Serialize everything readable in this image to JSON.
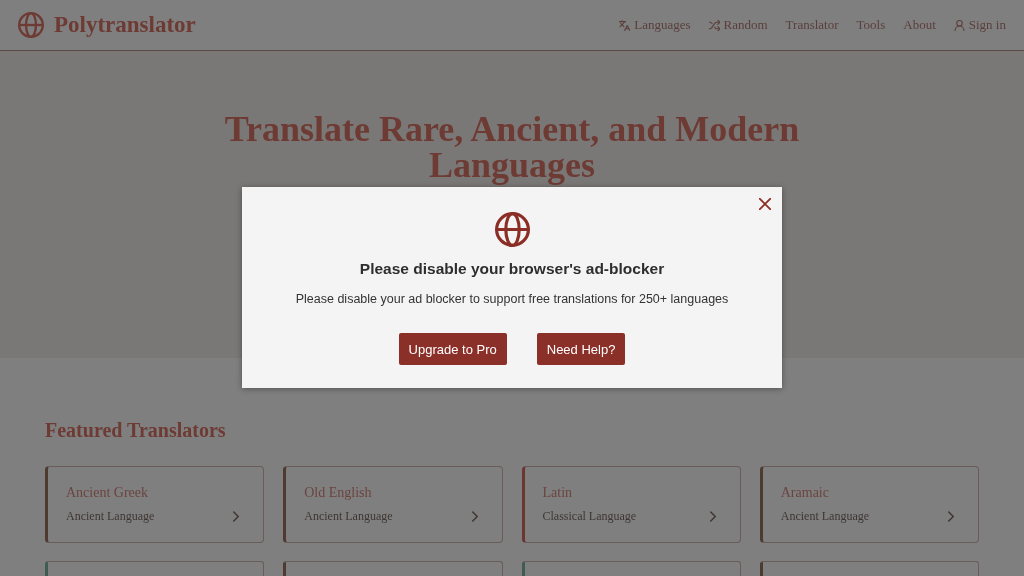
{
  "header": {
    "brand": "Polytranslator",
    "nav": [
      {
        "label": "Languages",
        "kind": "translate"
      },
      {
        "label": "Random",
        "kind": "shuffle"
      },
      {
        "label": "Translator",
        "kind": "plain"
      },
      {
        "label": "Tools",
        "kind": "plain"
      },
      {
        "label": "About",
        "kind": "plain"
      },
      {
        "label": "Sign in",
        "kind": "account"
      }
    ]
  },
  "hero": {
    "title": "Translate Rare, Ancient, and Modern Languages"
  },
  "featured": {
    "heading": "Featured Translators",
    "cards": [
      {
        "name": "Ancient Greek",
        "category": "Ancient Language",
        "color": "#4e3a31"
      },
      {
        "name": "Old English",
        "category": "Ancient Language",
        "color": "#4e3a31"
      },
      {
        "name": "Latin",
        "category": "Classical Language",
        "color": "#6d3530"
      },
      {
        "name": "Aramaic",
        "category": "Ancient Language",
        "color": "#4e3a31"
      }
    ],
    "cut_off_cards": [
      {
        "color": "#3f5b54"
      },
      {
        "color": "#4e3a31"
      },
      {
        "color": "#3f5b54"
      },
      {
        "color": "#4e3a31"
      }
    ]
  },
  "modal": {
    "title": "Please disable your browser's ad-blocker",
    "message": "Please disable your ad blocker to support free translations for 250+ languages",
    "buttons": [
      "Upgrade to Pro",
      "Need Help?"
    ]
  }
}
